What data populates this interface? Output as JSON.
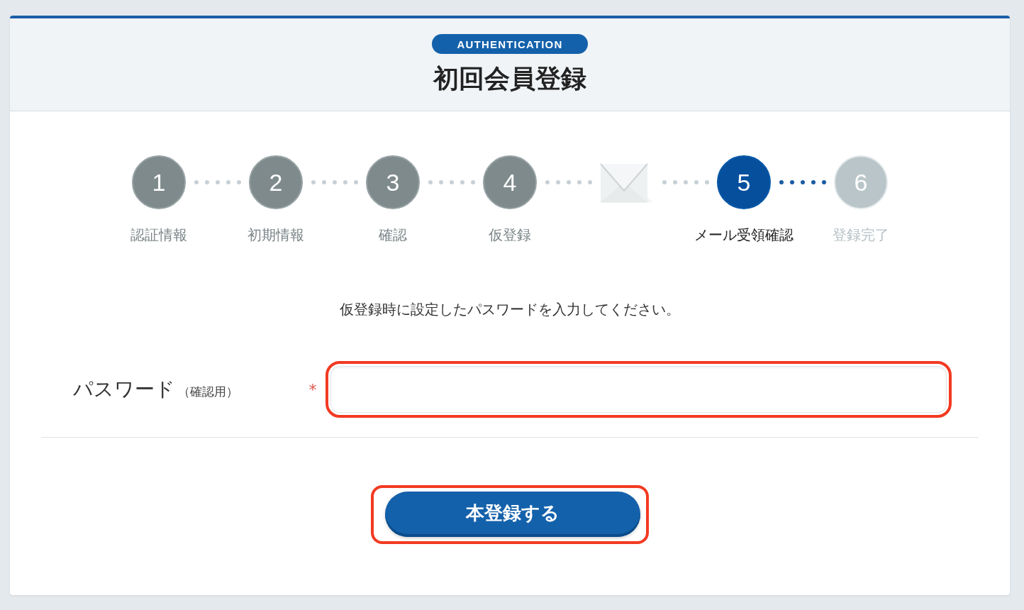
{
  "header": {
    "badge": "AUTHENTICATION",
    "title": "初回会員登録"
  },
  "steps": [
    {
      "kind": "number",
      "number": "1",
      "label": "認証情報",
      "completed": true,
      "current": false
    },
    {
      "kind": "number",
      "number": "2",
      "label": "初期情報",
      "completed": true,
      "current": false
    },
    {
      "kind": "number",
      "number": "3",
      "label": "確認",
      "completed": true,
      "current": false
    },
    {
      "kind": "number",
      "number": "4",
      "label": "仮登録",
      "completed": true,
      "current": false
    },
    {
      "kind": "mail"
    },
    {
      "kind": "number",
      "number": "5",
      "label": "メール受領確認",
      "completed": false,
      "current": true
    },
    {
      "kind": "number",
      "number": "6",
      "label": "登録完了",
      "completed": false,
      "current": false
    }
  ],
  "instruction": "仮登録時に設定したパスワードを入力してください。",
  "form": {
    "fields": [
      {
        "label": "パスワード",
        "note": "（確認用）",
        "required_mark": "*",
        "highlighted": true
      }
    ]
  },
  "submit": {
    "label": "本登録する",
    "highlighted": true
  }
}
